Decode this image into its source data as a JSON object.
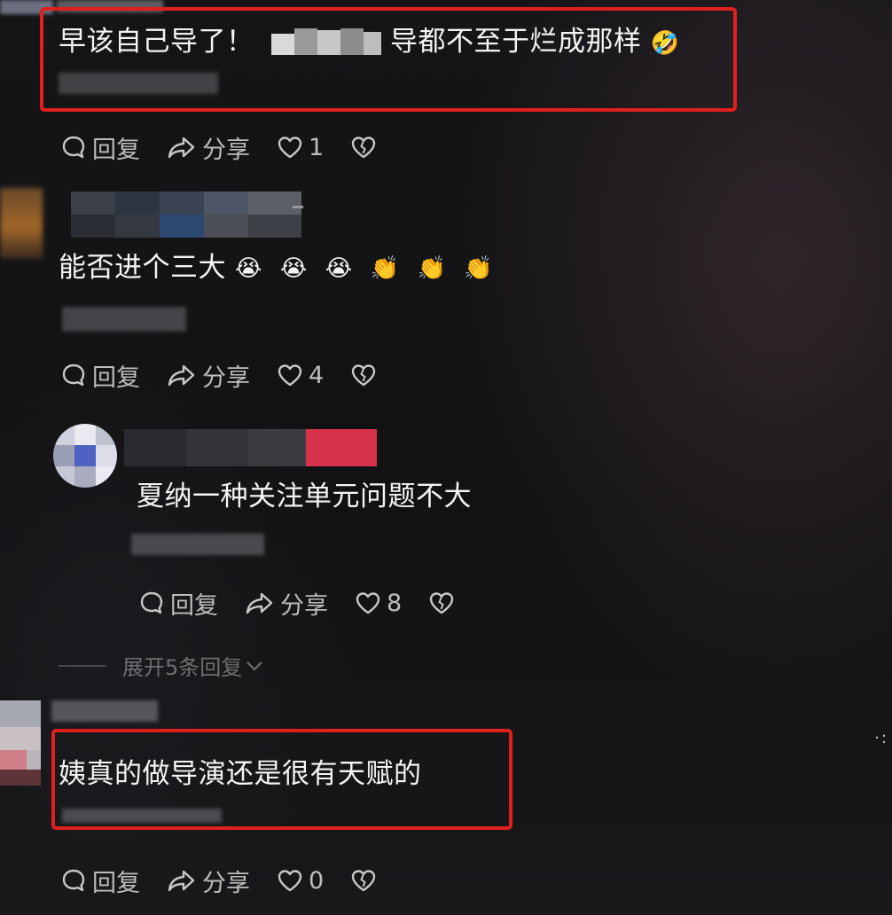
{
  "comments": [
    {
      "text_before": "早该自己导了！",
      "text_after": "导都不至于烂成那样",
      "emoji": "🤣",
      "actions": {
        "reply": "回复",
        "share": "分享",
        "likes": "1"
      }
    },
    {
      "text": "能否进个三大",
      "emojis": [
        "😭",
        "😭",
        "😭",
        "👏",
        "👏",
        "👏"
      ],
      "actions": {
        "reply": "回复",
        "share": "分享",
        "likes": "4"
      }
    },
    {
      "text": "夏纳一种关注单元问题不大",
      "actions": {
        "reply": "回复",
        "share": "分享",
        "likes": "8"
      },
      "expand_replies": "展开5条回复"
    },
    {
      "text": "姨真的做导演还是很有天赋的",
      "actions": {
        "reply": "回复",
        "share": "分享",
        "likes": "0"
      }
    }
  ],
  "colors": {
    "highlight": "#e0201e",
    "text": "#f4f4f4",
    "muted": "#bdbdbd"
  },
  "icons": [
    "comment-icon",
    "share-icon",
    "heart-icon",
    "broken-heart-icon",
    "chevron-down-icon",
    "more-icon"
  ]
}
